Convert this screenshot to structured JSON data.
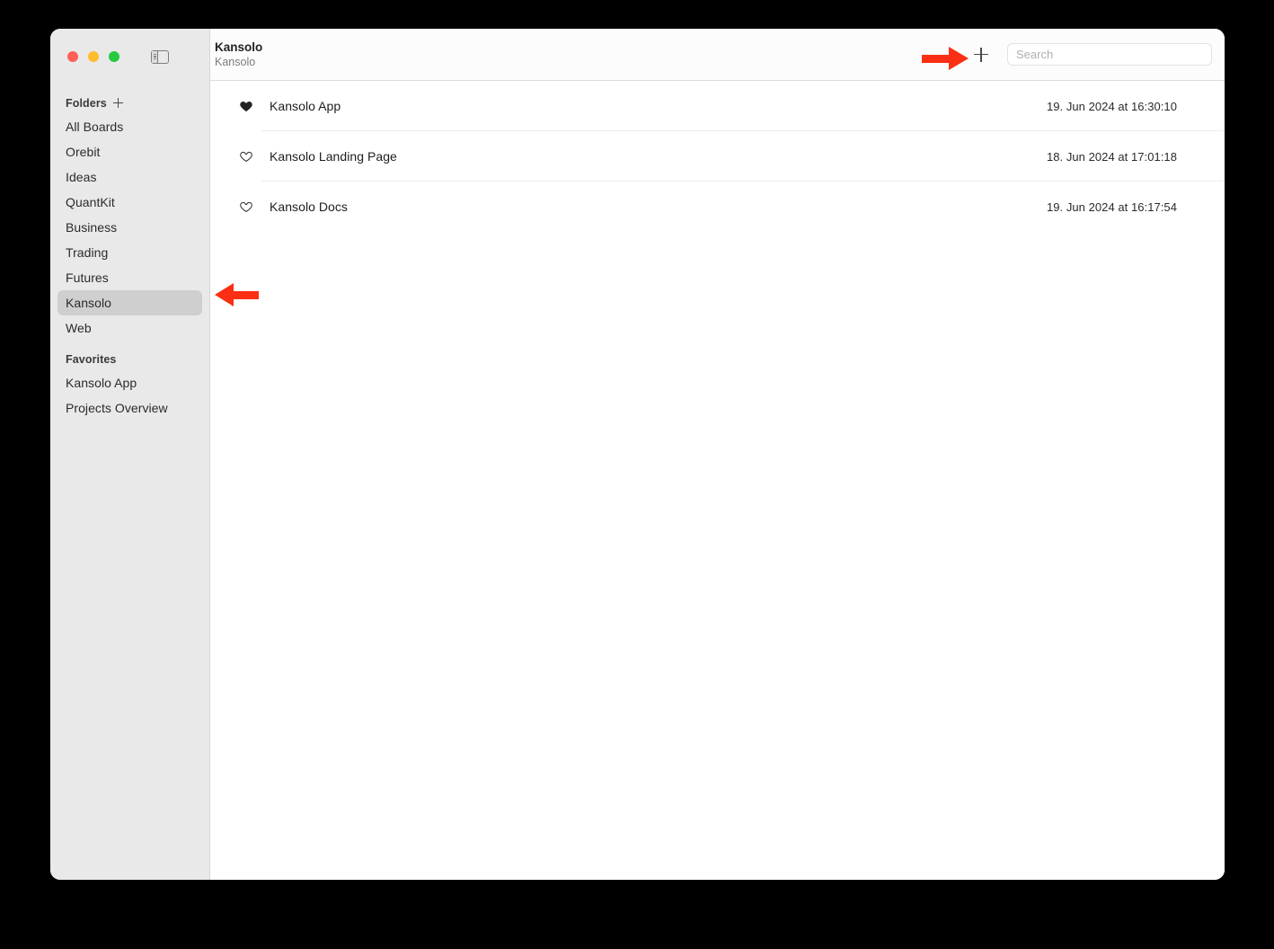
{
  "window": {
    "traffic_lights": [
      "close",
      "minimize",
      "zoom"
    ],
    "sidebar_toggle_icon": "sidebar-toggle-icon"
  },
  "sidebar": {
    "sections": [
      {
        "label": "Folders",
        "has_add": true,
        "add_icon": "plus-icon",
        "items": [
          {
            "label": "All Boards",
            "selected": false
          },
          {
            "label": "Orebit",
            "selected": false
          },
          {
            "label": "Ideas",
            "selected": false
          },
          {
            "label": "QuantKit",
            "selected": false
          },
          {
            "label": "Business",
            "selected": false
          },
          {
            "label": "Trading",
            "selected": false
          },
          {
            "label": "Futures",
            "selected": false
          },
          {
            "label": "Kansolo",
            "selected": true
          },
          {
            "label": "Web",
            "selected": false
          }
        ]
      },
      {
        "label": "Favorites",
        "has_add": false,
        "items": [
          {
            "label": "Kansolo App",
            "selected": false
          },
          {
            "label": "Projects Overview",
            "selected": false
          }
        ]
      }
    ]
  },
  "toolbar": {
    "title": "Kansolo",
    "subtitle": "Kansolo",
    "add_button_icon": "plus-icon",
    "search": {
      "placeholder": "Search",
      "value": ""
    }
  },
  "board_list": {
    "rows": [
      {
        "name": "Kansolo App",
        "date": "19. Jun 2024 at 16:30:10",
        "favorite": true,
        "icon": "heart-filled-icon"
      },
      {
        "name": "Kansolo Landing Page",
        "date": "18. Jun 2024 at 17:01:18",
        "favorite": false,
        "icon": "heart-outline-icon"
      },
      {
        "name": "Kansolo Docs",
        "date": "19. Jun 2024 at 16:17:54",
        "favorite": false,
        "icon": "heart-outline-icon"
      }
    ]
  },
  "annotations": {
    "color": "#fa2f13",
    "arrows": [
      {
        "name": "arrow-pointing-to-add-button",
        "direction": "right"
      },
      {
        "name": "arrow-pointing-to-kansolo-folder",
        "direction": "left"
      }
    ]
  }
}
